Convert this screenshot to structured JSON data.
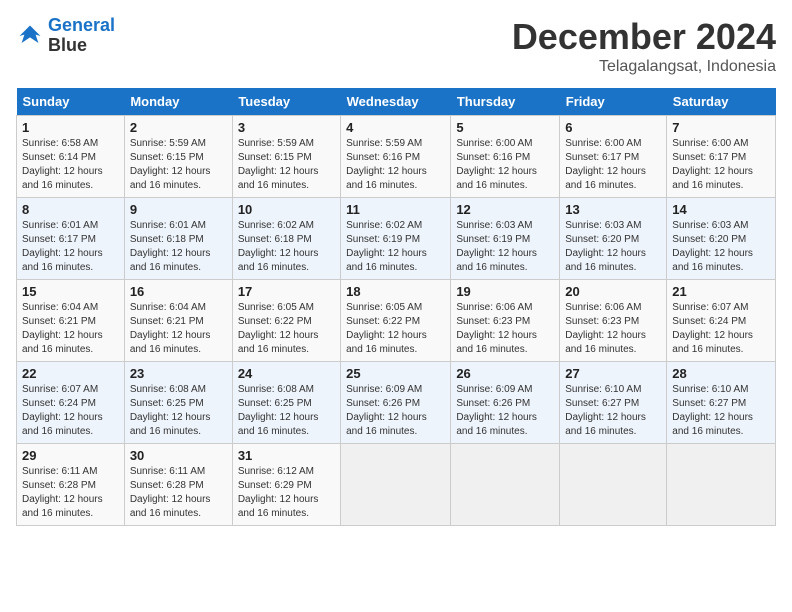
{
  "header": {
    "logo_line1": "General",
    "logo_line2": "Blue",
    "month": "December 2024",
    "location": "Telagalangsat, Indonesia"
  },
  "weekdays": [
    "Sunday",
    "Monday",
    "Tuesday",
    "Wednesday",
    "Thursday",
    "Friday",
    "Saturday"
  ],
  "weeks": [
    [
      {
        "day": "1",
        "sunrise": "6:58 AM",
        "sunset": "6:14 PM",
        "daylight": "12 hours and 16 minutes"
      },
      {
        "day": "2",
        "sunrise": "5:59 AM",
        "sunset": "6:15 PM",
        "daylight": "12 hours and 16 minutes"
      },
      {
        "day": "3",
        "sunrise": "5:59 AM",
        "sunset": "6:15 PM",
        "daylight": "12 hours and 16 minutes"
      },
      {
        "day": "4",
        "sunrise": "5:59 AM",
        "sunset": "6:16 PM",
        "daylight": "12 hours and 16 minutes"
      },
      {
        "day": "5",
        "sunrise": "6:00 AM",
        "sunset": "6:16 PM",
        "daylight": "12 hours and 16 minutes"
      },
      {
        "day": "6",
        "sunrise": "6:00 AM",
        "sunset": "6:17 PM",
        "daylight": "12 hours and 16 minutes"
      },
      {
        "day": "7",
        "sunrise": "6:00 AM",
        "sunset": "6:17 PM",
        "daylight": "12 hours and 16 minutes"
      }
    ],
    [
      {
        "day": "8",
        "sunrise": "6:01 AM",
        "sunset": "6:17 PM",
        "daylight": "12 hours and 16 minutes"
      },
      {
        "day": "9",
        "sunrise": "6:01 AM",
        "sunset": "6:18 PM",
        "daylight": "12 hours and 16 minutes"
      },
      {
        "day": "10",
        "sunrise": "6:02 AM",
        "sunset": "6:18 PM",
        "daylight": "12 hours and 16 minutes"
      },
      {
        "day": "11",
        "sunrise": "6:02 AM",
        "sunset": "6:19 PM",
        "daylight": "12 hours and 16 minutes"
      },
      {
        "day": "12",
        "sunrise": "6:03 AM",
        "sunset": "6:19 PM",
        "daylight": "12 hours and 16 minutes"
      },
      {
        "day": "13",
        "sunrise": "6:03 AM",
        "sunset": "6:20 PM",
        "daylight": "12 hours and 16 minutes"
      },
      {
        "day": "14",
        "sunrise": "6:03 AM",
        "sunset": "6:20 PM",
        "daylight": "12 hours and 16 minutes"
      }
    ],
    [
      {
        "day": "15",
        "sunrise": "6:04 AM",
        "sunset": "6:21 PM",
        "daylight": "12 hours and 16 minutes"
      },
      {
        "day": "16",
        "sunrise": "6:04 AM",
        "sunset": "6:21 PM",
        "daylight": "12 hours and 16 minutes"
      },
      {
        "day": "17",
        "sunrise": "6:05 AM",
        "sunset": "6:22 PM",
        "daylight": "12 hours and 16 minutes"
      },
      {
        "day": "18",
        "sunrise": "6:05 AM",
        "sunset": "6:22 PM",
        "daylight": "12 hours and 16 minutes"
      },
      {
        "day": "19",
        "sunrise": "6:06 AM",
        "sunset": "6:23 PM",
        "daylight": "12 hours and 16 minutes"
      },
      {
        "day": "20",
        "sunrise": "6:06 AM",
        "sunset": "6:23 PM",
        "daylight": "12 hours and 16 minutes"
      },
      {
        "day": "21",
        "sunrise": "6:07 AM",
        "sunset": "6:24 PM",
        "daylight": "12 hours and 16 minutes"
      }
    ],
    [
      {
        "day": "22",
        "sunrise": "6:07 AM",
        "sunset": "6:24 PM",
        "daylight": "12 hours and 16 minutes"
      },
      {
        "day": "23",
        "sunrise": "6:08 AM",
        "sunset": "6:25 PM",
        "daylight": "12 hours and 16 minutes"
      },
      {
        "day": "24",
        "sunrise": "6:08 AM",
        "sunset": "6:25 PM",
        "daylight": "12 hours and 16 minutes"
      },
      {
        "day": "25",
        "sunrise": "6:09 AM",
        "sunset": "6:26 PM",
        "daylight": "12 hours and 16 minutes"
      },
      {
        "day": "26",
        "sunrise": "6:09 AM",
        "sunset": "6:26 PM",
        "daylight": "12 hours and 16 minutes"
      },
      {
        "day": "27",
        "sunrise": "6:10 AM",
        "sunset": "6:27 PM",
        "daylight": "12 hours and 16 minutes"
      },
      {
        "day": "28",
        "sunrise": "6:10 AM",
        "sunset": "6:27 PM",
        "daylight": "12 hours and 16 minutes"
      }
    ],
    [
      {
        "day": "29",
        "sunrise": "6:11 AM",
        "sunset": "6:28 PM",
        "daylight": "12 hours and 16 minutes"
      },
      {
        "day": "30",
        "sunrise": "6:11 AM",
        "sunset": "6:28 PM",
        "daylight": "12 hours and 16 minutes"
      },
      {
        "day": "31",
        "sunrise": "6:12 AM",
        "sunset": "6:29 PM",
        "daylight": "12 hours and 16 minutes"
      },
      null,
      null,
      null,
      null
    ]
  ],
  "labels": {
    "sunrise_prefix": "Sunrise: ",
    "sunset_prefix": "Sunset: ",
    "daylight_prefix": "Daylight: "
  }
}
